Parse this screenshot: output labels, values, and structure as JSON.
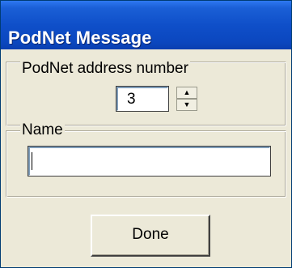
{
  "window": {
    "title": "PodNet Message"
  },
  "address_group": {
    "label": "PodNet address number",
    "value": "3",
    "up_arrow": "▲",
    "down_arrow": "▼"
  },
  "name_group": {
    "label": "Name",
    "value": ""
  },
  "buttons": {
    "done_label": "Done"
  },
  "colors": {
    "titlebar": "#0f4fc9",
    "window_face": "#ece9d8",
    "field_border": "#7f9db9"
  },
  "icons": {
    "spin_up": "spin-up-arrow-icon",
    "spin_down": "spin-down-arrow-icon"
  }
}
